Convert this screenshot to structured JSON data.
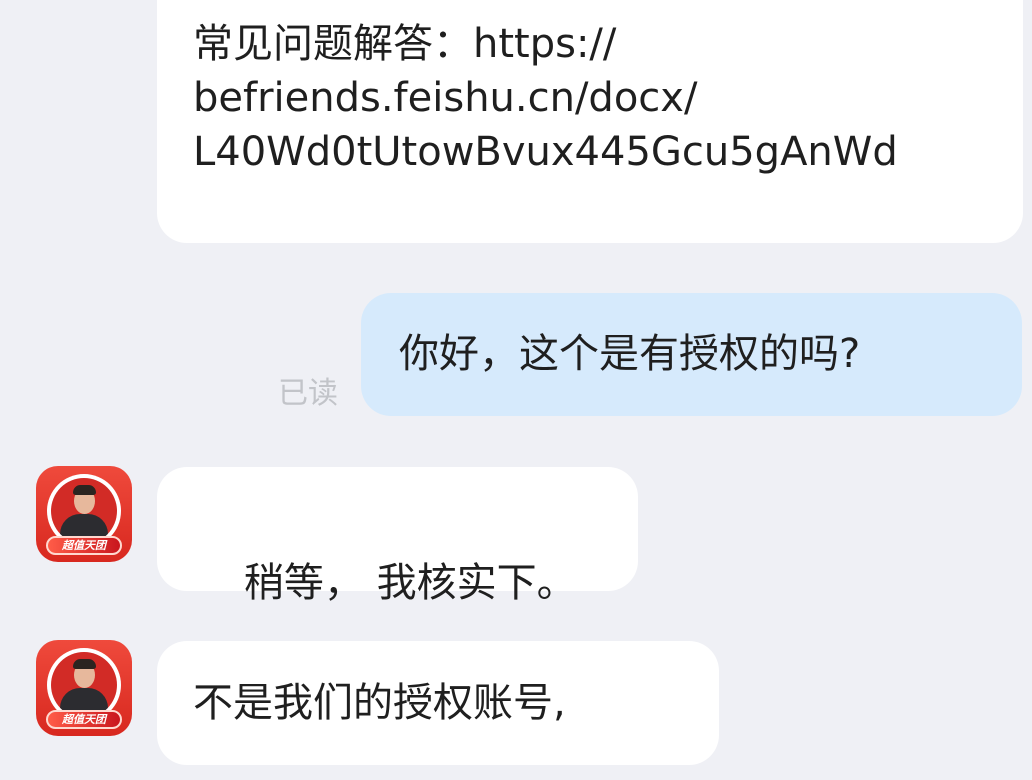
{
  "messages": {
    "faq": {
      "lines": [
        "常见问题解答：https://",
        "befriends.feishu.cn/docx/",
        "L40Wd0tUtowBvux445Gcu5gAnWd"
      ]
    },
    "question": {
      "text": "你好，这个是有授权的吗?",
      "read_status": "已读"
    },
    "reply_1": {
      "text": "稍等， 我核实下。"
    },
    "reply_2": {
      "text": "不是我们的授权账号,"
    }
  },
  "avatar": {
    "badge_text": "超值天团",
    "icon": "seller-avatar-icon",
    "brand_color": "#d8281f"
  },
  "colors": {
    "background": "#eff0f5",
    "incoming_bubble": "#ffffff",
    "outgoing_bubble": "#d6eafc",
    "read_status": "#c2c4c9"
  }
}
